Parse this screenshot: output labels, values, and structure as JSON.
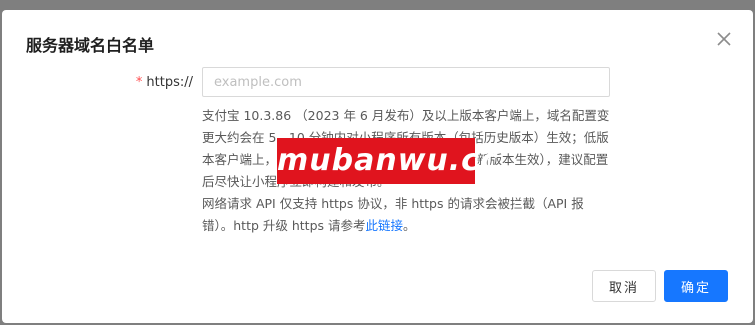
{
  "modal": {
    "title": "服务器域名白名单"
  },
  "form": {
    "required_mark": "*",
    "label": "https://",
    "input_value": "",
    "input_placeholder": "example.com"
  },
  "help": {
    "paragraph1": "支付宝 10.3.86 （2023 年 6 月发布）及以上版本客户端上，域名配置变更大约会在 5 - 10 分钟内对小程序所有版本（包括历史版本）生效；低版本客户端上，需要小程序重新构建和发版（即只对新版本生效），建议配置后尽快让小程序立即构建和发布。",
    "paragraph2_text": "网络请求 API 仅支持 https 协议，非 https 的请求会被拦截（API 报错）。http 升级 https 请参考",
    "link_label": "此链接",
    "paragraph2_end": "。"
  },
  "footer": {
    "cancel_label": "取消",
    "ok_label": "确定"
  },
  "watermark": {
    "text": "mubanwu.cc"
  },
  "colors": {
    "primary": "#1677ff",
    "required": "#ff4d4f",
    "watermark_bg": "#e0141e",
    "overlay": "#7f7f7f"
  }
}
